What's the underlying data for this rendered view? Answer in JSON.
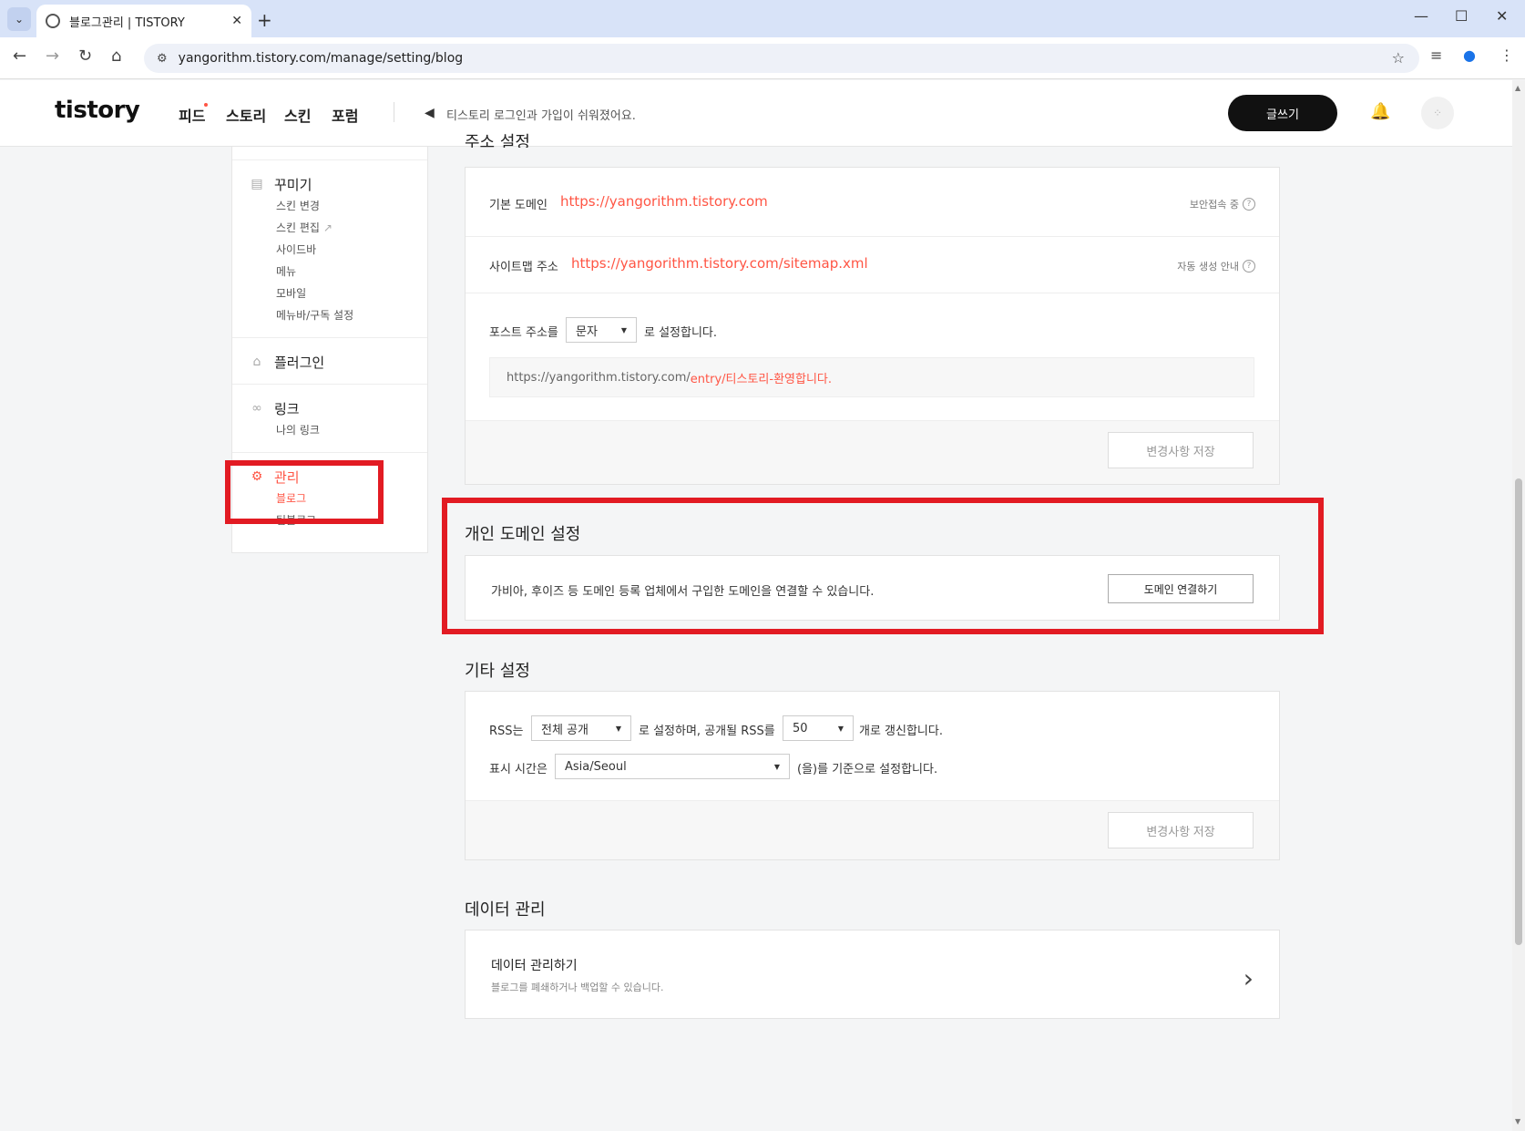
{
  "browser": {
    "tab_title": "블로그관리 | TISTORY",
    "url": "yangorithm.tistory.com/manage/setting/blog"
  },
  "header": {
    "logo": "tistory",
    "nav": [
      "피드",
      "스토리",
      "스킨",
      "포럼"
    ],
    "notice": "티스토리 로그인과 가입이 쉬워졌어요.",
    "write_label": "글쓰기"
  },
  "sidebar": {
    "groups": [
      {
        "title": "꾸미기",
        "items": [
          "스킨 변경",
          "스킨 편집",
          "사이드바",
          "메뉴",
          "모바일",
          "메뉴바/구독 설정"
        ]
      },
      {
        "title": "플러그인",
        "items": []
      },
      {
        "title": "링크",
        "items": [
          "나의 링크"
        ]
      },
      {
        "title": "관리",
        "items": [
          "블로그",
          "팀블로그"
        ]
      }
    ]
  },
  "address": {
    "partial_title": "주소 설정",
    "default_domain_label": "기본 도메인",
    "default_domain_url": "https://yangorithm.tistory.com",
    "secure_label": "보안접속 중",
    "sitemap_label": "사이트맵 주소",
    "sitemap_url": "https://yangorithm.tistory.com/sitemap.xml",
    "sitemap_help": "자동 생성 안내",
    "post_prefix": "포스트 주소를",
    "post_select": "문자",
    "post_suffix": "로 설정합니다.",
    "preview_base": "https://yangorithm.tistory.com/",
    "preview_path": "entry/티스토리-환영합니다.",
    "save_label": "변경사항 저장"
  },
  "custom_domain": {
    "title": "개인 도메인 설정",
    "desc": "가비아, 후이즈 등 도메인 등록 업체에서 구입한 도메인을 연결할 수 있습니다.",
    "button": "도메인 연결하기"
  },
  "etc": {
    "title": "기타 설정",
    "rss_prefix": "RSS는",
    "rss_select": "전체 공개",
    "rss_middle": "로 설정하며, 공개될 RSS를",
    "rss_count": "50",
    "rss_suffix": "개로 갱신합니다.",
    "time_prefix": "표시 시간은",
    "time_select": "Asia/Seoul",
    "time_suffix": "(을)를 기준으로 설정합니다.",
    "save_label": "변경사항 저장"
  },
  "data": {
    "title": "데이터 관리",
    "link_title": "데이터 관리하기",
    "link_desc": "블로그를 폐쇄하거나 백업할 수 있습니다."
  },
  "colors": {
    "accent": "#ff5544",
    "highlight": "#e21b23"
  }
}
